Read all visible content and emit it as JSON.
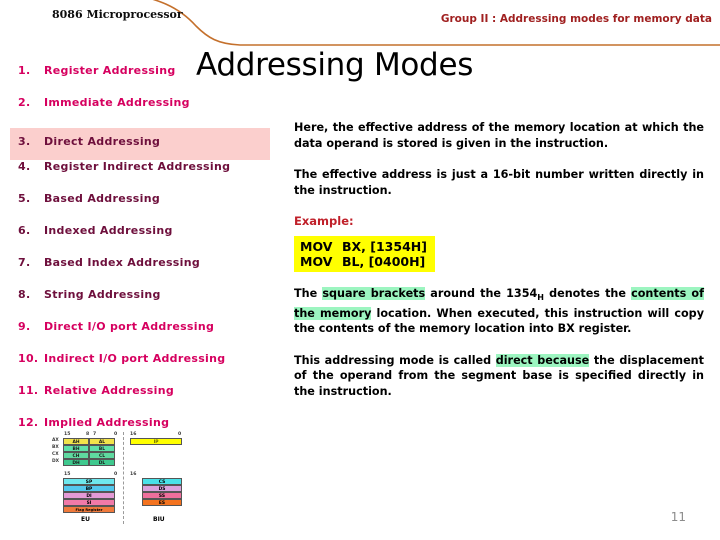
{
  "header": {
    "subject": "8086 Microprocessor",
    "group_label": "Group II : Addressing modes for memory data",
    "accent_color": "#c4702c",
    "group_color": "#a02020"
  },
  "title": "Addressing Modes",
  "modes": {
    "bright_color": "#d6005f",
    "dark_color": "#6e0f3c",
    "highlight_bg": "#fbcfcd",
    "items": [
      {
        "num": "1.",
        "label": "Register Addressing",
        "style": "bright"
      },
      {
        "num": "2.",
        "label": "Immediate Addressing",
        "style": "bright"
      },
      {
        "num": "3.",
        "label": "Direct Addressing",
        "style": "hl"
      },
      {
        "num": "4.",
        "label": "Register Indirect Addressing",
        "style": "dark"
      },
      {
        "num": "5.",
        "label": "Based Addressing",
        "style": "dark"
      },
      {
        "num": "6.",
        "label": "Indexed Addressing",
        "style": "dark"
      },
      {
        "num": "7.",
        "label": "Based Index Addressing",
        "style": "dark"
      },
      {
        "num": "8.",
        "label": "String Addressing",
        "style": "dark"
      },
      {
        "num": "9.",
        "label": "Direct I/O port Addressing",
        "style": "bright"
      },
      {
        "num": "10.",
        "label": "Indirect I/O port Addressing",
        "style": "bright"
      },
      {
        "num": "11.",
        "label": "Relative Addressing",
        "style": "bright"
      },
      {
        "num": "12.",
        "label": "Implied Addressing",
        "style": "bright"
      }
    ]
  },
  "content": {
    "paragraph_1": "Here,  the  effective     address  of  the  memory location at which the data operand is stored  is given in the instruction.",
    "paragraph_2": "The   effective address is just a 16-bit number written directly in the instruction.",
    "example_label": "Example:",
    "code": {
      "background": "#ffff00",
      "lines": [
        {
          "mnemonic": "MOV",
          "operands": "BX, [1354H]"
        },
        {
          "mnemonic": "MOV",
          "operands": "BL, [0400H]"
        }
      ]
    },
    "paragraph_3": {
      "seg_1": "The ",
      "hl_1": "square brackets",
      "seg_2": " around the  1354",
      "sub_1": "H",
      "seg_3": " denotes the ",
      "hl_2": "contents of the memory",
      "seg_4": " location. When executed, this instruction will copy the contents of the memory location into BX register."
    },
    "paragraph_4": {
      "seg_1": "This addressing mode is called ",
      "hl_1": "direct because",
      "seg_2": " the displacement of the operand from the segment base is specified directly in the instruction."
    },
    "highlight_color": "#9cf5c0"
  },
  "diagram": {
    "eu_label": "EU",
    "biu_label": "BIU",
    "bit_labels": {
      "left_high": "15",
      "left_mid_a": "8",
      "left_mid_b": "7",
      "left_low": "0",
      "right_high": "16",
      "right_low": "0",
      "ptr_high": "15",
      "ptr_low": "0",
      "seg_high": "16"
    },
    "general_registers": [
      {
        "name": "AX",
        "hi": "AH",
        "lo": "AL",
        "hi_color": "#f2e34a",
        "lo_color": "#f2e34a"
      },
      {
        "name": "BX",
        "hi": "BH",
        "lo": "BL",
        "hi_color": "#5fe0a8",
        "lo_color": "#5fe0a8"
      },
      {
        "name": "CX",
        "hi": "CH",
        "lo": "CL",
        "hi_color": "#5fd9a0",
        "lo_color": "#5fd9a0"
      },
      {
        "name": "DX",
        "hi": "DH",
        "lo": "DL",
        "hi_color": "#3fc98e",
        "lo_color": "#3fc98e"
      }
    ],
    "pointer_registers": [
      {
        "name": "SP",
        "color": "#6fe8ee"
      },
      {
        "name": "BP",
        "color": "#53c8ee"
      },
      {
        "name": "DI",
        "color": "#e49ad6"
      },
      {
        "name": "SI",
        "color": "#f07aa8"
      },
      {
        "name": "Flag Register",
        "color": "#f07a3c"
      }
    ],
    "segment_registers": [
      {
        "name": "CS",
        "color": "#49e2e8"
      },
      {
        "name": "DS",
        "color": "#dba2dd"
      },
      {
        "name": "SS",
        "color": "#ef6f9c"
      },
      {
        "name": "ES",
        "color": "#f4731f"
      }
    ],
    "ip_register": {
      "name": "IP",
      "color": "#ffff00"
    }
  },
  "page_number": "11"
}
